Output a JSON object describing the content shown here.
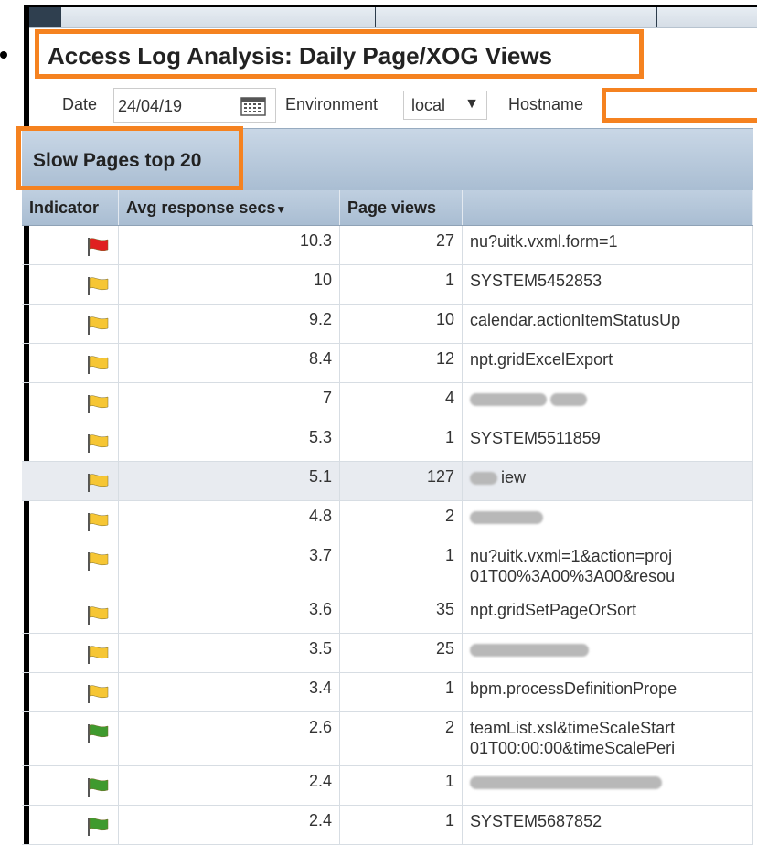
{
  "title": "Access Log Analysis: Daily Page/XOG Views",
  "filters": {
    "date_label": "Date",
    "date_value": "24/04/19",
    "environment_label": "Environment",
    "environment_value": "local",
    "hostname_label": "Hostname",
    "hostname_value": ""
  },
  "section_title": "Slow Pages top 20",
  "table": {
    "headers": [
      "Indicator",
      "Avg response secs",
      "Page views",
      ""
    ],
    "rows": [
      {
        "indicator": "red",
        "avg": "10.3",
        "views": "27",
        "page": "nu?uitk.vxml.form=1"
      },
      {
        "indicator": "yellow",
        "avg": "10",
        "views": "1",
        "page": "SYSTEM5452853"
      },
      {
        "indicator": "yellow",
        "avg": "9.2",
        "views": "10",
        "page": "calendar.actionItemStatusUp"
      },
      {
        "indicator": "yellow",
        "avg": "8.4",
        "views": "12",
        "page": "npt.gridExcelExport"
      },
      {
        "indicator": "yellow",
        "avg": "7",
        "views": "4",
        "page": ""
      },
      {
        "indicator": "yellow",
        "avg": "5.3",
        "views": "1",
        "page": "SYSTEM5511859"
      },
      {
        "indicator": "yellow",
        "avg": "5.1",
        "views": "127",
        "page": "iew"
      },
      {
        "indicator": "yellow",
        "avg": "4.8",
        "views": "2",
        "page": ""
      },
      {
        "indicator": "yellow",
        "avg": "3.7",
        "views": "1",
        "page": "nu?uitk.vxml=1&action=proj\n01T00%3A00%3A00&resou"
      },
      {
        "indicator": "yellow",
        "avg": "3.6",
        "views": "35",
        "page": "npt.gridSetPageOrSort"
      },
      {
        "indicator": "yellow",
        "avg": "3.5",
        "views": "25",
        "page": ""
      },
      {
        "indicator": "yellow",
        "avg": "3.4",
        "views": "1",
        "page": "bpm.processDefinitionPrope"
      },
      {
        "indicator": "green",
        "avg": "2.6",
        "views": "2",
        "page": "teamList.xsl&timeScaleStart\n01T00:00:00&timeScalePeri"
      },
      {
        "indicator": "green",
        "avg": "2.4",
        "views": "1",
        "page": ""
      },
      {
        "indicator": "green",
        "avg": "2.4",
        "views": "1",
        "page": "SYSTEM5687852"
      }
    ]
  },
  "flag_colors": {
    "red": "#e02020",
    "yellow": "#f6c634",
    "green": "#3f9a2e"
  },
  "accent_outline": "#f58220"
}
